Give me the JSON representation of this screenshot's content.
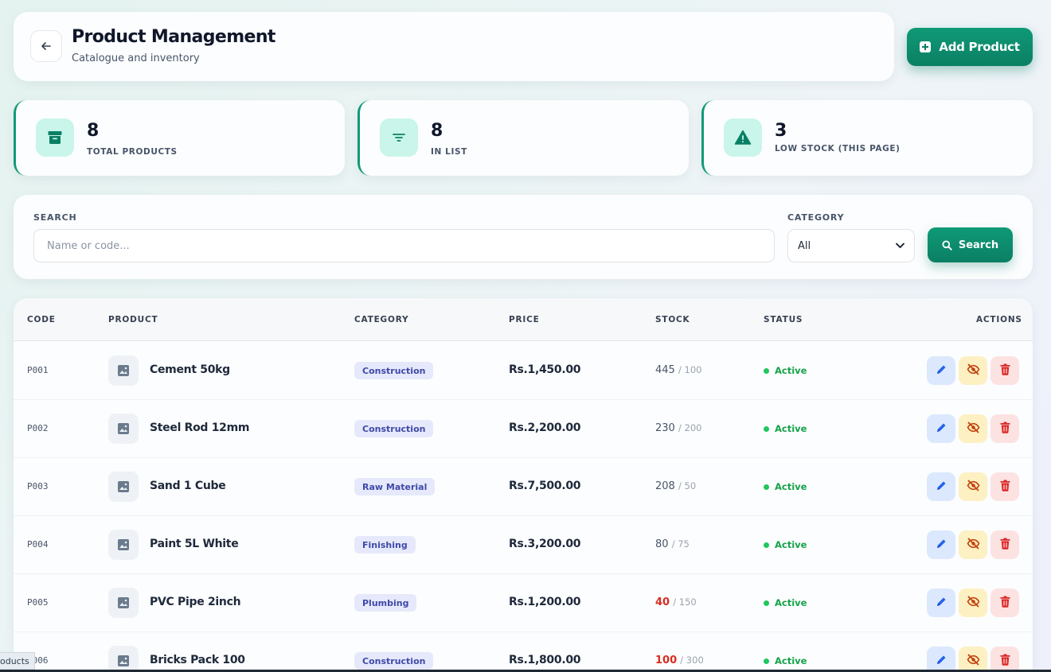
{
  "header": {
    "title": "Product Management",
    "subtitle": "Catalogue and inventory",
    "add_label": "Add Product"
  },
  "stats": [
    {
      "value": "8",
      "label": "TOTAL PRODUCTS",
      "icon": "archive-icon"
    },
    {
      "value": "8",
      "label": "IN LIST",
      "icon": "filter-icon"
    },
    {
      "value": "3",
      "label": "LOW STOCK (THIS PAGE)",
      "icon": "warning-icon"
    }
  ],
  "filter": {
    "search_label": "SEARCH",
    "search_placeholder": "Name or code...",
    "category_label": "CATEGORY",
    "category_selected": "All",
    "search_button": "Search"
  },
  "table": {
    "columns": [
      "CODE",
      "PRODUCT",
      "CATEGORY",
      "PRICE",
      "STOCK",
      "STATUS",
      "ACTIONS"
    ],
    "rows": [
      {
        "code": "P001",
        "name": "Cement 50kg",
        "category": "Construction",
        "price": "Rs.1,450.00",
        "stock": "445",
        "min": "/ 100",
        "low": false,
        "status": "Active"
      },
      {
        "code": "P002",
        "name": "Steel Rod 12mm",
        "category": "Construction",
        "price": "Rs.2,200.00",
        "stock": "230",
        "min": "/ 200",
        "low": false,
        "status": "Active"
      },
      {
        "code": "P003",
        "name": "Sand 1 Cube",
        "category": "Raw Material",
        "price": "Rs.7,500.00",
        "stock": "208",
        "min": "/ 50",
        "low": false,
        "status": "Active"
      },
      {
        "code": "P004",
        "name": "Paint 5L White",
        "category": "Finishing",
        "price": "Rs.3,200.00",
        "stock": "80",
        "min": "/ 75",
        "low": false,
        "status": "Active"
      },
      {
        "code": "P005",
        "name": "PVC Pipe 2inch",
        "category": "Plumbing",
        "price": "Rs.1,200.00",
        "stock": "40",
        "min": "/ 150",
        "low": true,
        "status": "Active"
      },
      {
        "code": "P006",
        "name": "Bricks Pack 100",
        "category": "Construction",
        "price": "Rs.1,800.00",
        "stock": "100",
        "min": "/ 300",
        "low": true,
        "status": "Active"
      }
    ]
  },
  "bottom_tab": "oducts",
  "colors": {
    "accent": "#0f9a77",
    "low_stock": "#d92d20",
    "active": "#16a34a"
  }
}
